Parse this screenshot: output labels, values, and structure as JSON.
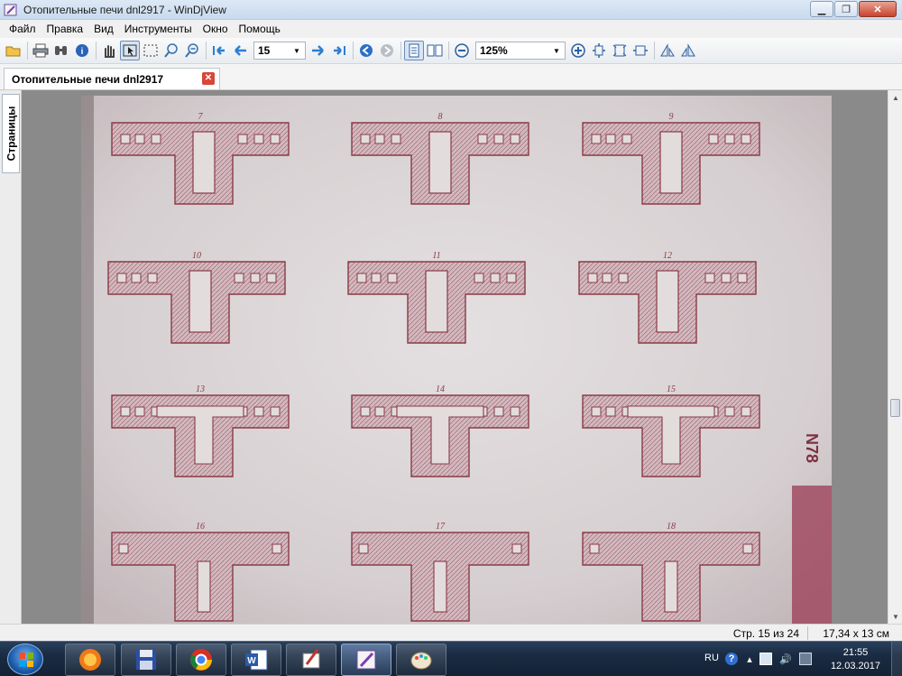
{
  "window": {
    "title": "Отопительные печи dnl2917 - WinDjView",
    "minimize_glyph": "▁",
    "restore_glyph": "❐",
    "close_glyph": "✕"
  },
  "menu": [
    "Файл",
    "Правка",
    "Вид",
    "Инструменты",
    "Окно",
    "Помощь"
  ],
  "toolbar": {
    "page_number": "15",
    "zoom": "125%",
    "icons": [
      "open-icon",
      "print-icon",
      "find-icon",
      "info-icon",
      "hand-tool-icon",
      "select-tool-icon",
      "rect-select-icon",
      "zoom-in-tool-icon",
      "zoom-out-tool-icon",
      "first-page-icon",
      "prev-page-icon",
      "next-page-icon",
      "last-page-icon",
      "back-icon",
      "forward-icon",
      "single-page-icon",
      "facing-pages-icon",
      "zoom-out-icon",
      "zoom-in-icon",
      "fit-page-icon",
      "fit-width-icon",
      "actual-size-icon",
      "rotate-left-icon",
      "rotate-right-icon"
    ]
  },
  "tab": {
    "label": "Отопительные печи dnl2917",
    "close_glyph": "✕"
  },
  "sidebar": {
    "tab_label": "Страницы"
  },
  "page": {
    "figure_numbers": [
      "7",
      "8",
      "9",
      "10",
      "11",
      "12",
      "13",
      "14",
      "15",
      "16",
      "17",
      "18"
    ],
    "margin_mark": "N78"
  },
  "statusbar": {
    "page_info": "Стр. 15 из 24",
    "page_size": "17,34 x 13 см"
  },
  "taskbar": {
    "apps": [
      "firefox-icon",
      "save-icon",
      "chrome-icon",
      "word-icon",
      "paint-brush-icon",
      "windjview-icon",
      "paint-icon"
    ],
    "language": "RU",
    "time": "21:55",
    "date": "12.03.2017"
  },
  "colors": {
    "titlebar": "#cfdef0",
    "paper": "#dcd6d6",
    "drawing_line": "#8a3a46",
    "taskbar": "#1e3250"
  }
}
